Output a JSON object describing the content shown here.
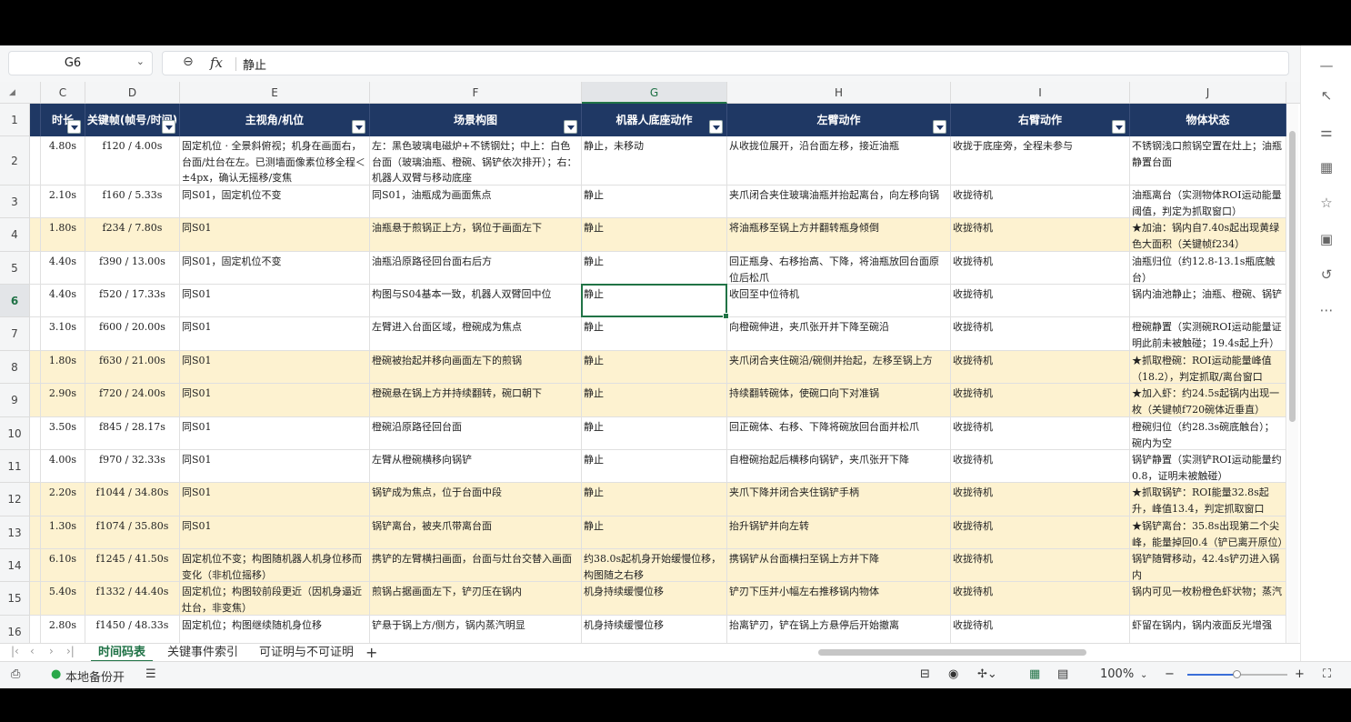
{
  "formula_bar": {
    "cell_ref": "G6",
    "fx_label": "fx",
    "value": "静止"
  },
  "columns": [
    {
      "letter": "C",
      "header": "时长"
    },
    {
      "letter": "D",
      "header": "关键帧(帧号/时间)"
    },
    {
      "letter": "E",
      "header": "主视角/机位"
    },
    {
      "letter": "F",
      "header": "场景构图"
    },
    {
      "letter": "G",
      "header": "机器人底座动作"
    },
    {
      "letter": "H",
      "header": "左臂动作"
    },
    {
      "letter": "I",
      "header": "右臂动作"
    },
    {
      "letter": "J",
      "header": "物体状态"
    }
  ],
  "rows": [
    {
      "num": "2",
      "C": "4.80s",
      "D": "f120 / 4.00s",
      "E": "固定机位 · 全景斜俯视；机身在画面右，台面/灶台在左。已测墙面像素位移全程＜±4px，确认无摇移/变焦",
      "F": "左：黑色玻璃电磁炉+不锈钢灶；中上：白色台面（玻璃油瓶、橙碗、锅铲依次排开）；右：机器人双臂与移动底座",
      "G": "静止，未移动",
      "H": "从收拢位展开，沿台面左移，接近油瓶",
      "I": "收拢于底座旁，全程未参与",
      "J": "不锈钢浅口煎锅空置在灶上；油瓶静置台面",
      "hl": false
    },
    {
      "num": "3",
      "C": "2.10s",
      "D": "f160 / 5.33s",
      "E": "同S01，固定机位不变",
      "F": "同S01，油瓶成为画面焦点",
      "G": "静止",
      "H": "夹爪闭合夹住玻璃油瓶并抬起离台，向左移向锅",
      "I": "收拢待机",
      "J": "油瓶离台（实测物体ROI运动能量阈值，判定为抓取窗口）",
      "hl": false
    },
    {
      "num": "4",
      "C": "1.80s",
      "D": "f234 / 7.80s",
      "E": "同S01",
      "F": "油瓶悬于煎锅正上方，锅位于画面左下",
      "G": "静止",
      "H": "将油瓶移至锅上方并翻转瓶身倾倒",
      "I": "收拢待机",
      "J": "★加油：锅内自7.40s起出现黄绿色大面积（关键帧f234）",
      "hl": true
    },
    {
      "num": "5",
      "C": "4.40s",
      "D": "f390 / 13.00s",
      "E": "同S01，固定机位不变",
      "F": "油瓶沿原路径回台面右后方",
      "G": "静止",
      "H": "回正瓶身、右移抬高、下降，将油瓶放回台面原位后松爪",
      "I": "收拢待机",
      "J": "油瓶归位（约12.8-13.1s瓶底触台）",
      "hl": false
    },
    {
      "num": "6",
      "C": "4.40s",
      "D": "f520 / 17.33s",
      "E": "同S01",
      "F": "构图与S04基本一致，机器人双臂回中位",
      "G": "静止",
      "H": "收回至中位待机",
      "I": "收拢待机",
      "J": "锅内油池静止；油瓶、橙碗、锅铲",
      "hl": false
    },
    {
      "num": "7",
      "C": "3.10s",
      "D": "f600 / 20.00s",
      "E": "同S01",
      "F": "左臂进入台面区域，橙碗成为焦点",
      "G": "静止",
      "H": "向橙碗伸进，夹爪张开并下降至碗沿",
      "I": "收拢待机",
      "J": "橙碗静置（实测碗ROI运动能量证明此前未被触碰；19.4s起上升）",
      "hl": false
    },
    {
      "num": "8",
      "C": "1.80s",
      "D": "f630 / 21.00s",
      "E": "同S01",
      "F": "橙碗被抬起并移向画面左下的煎锅",
      "G": "静止",
      "H": "夹爪闭合夹住碗沿/碗侧并抬起，左移至锅上方",
      "I": "收拢待机",
      "J": "★抓取橙碗：ROI运动能量峰值（18.2），判定抓取/离台窗口",
      "hl": true
    },
    {
      "num": "9",
      "C": "2.90s",
      "D": "f720 / 24.00s",
      "E": "同S01",
      "F": "橙碗悬在锅上方并持续翻转，碗口朝下",
      "G": "静止",
      "H": "持续翻转碗体，使碗口向下对准锅",
      "I": "收拢待机",
      "J": "★加入虾：约24.5s起锅内出现一枚（关键帧f720碗体近垂直）",
      "hl": true
    },
    {
      "num": "10",
      "C": "3.50s",
      "D": "f845 / 28.17s",
      "E": "同S01",
      "F": "橙碗沿原路径回台面",
      "G": "静止",
      "H": "回正碗体、右移、下降将碗放回台面并松爪",
      "I": "收拢待机",
      "J": "橙碗归位（约28.3s碗底触台）；碗内为空",
      "hl": false
    },
    {
      "num": "11",
      "C": "4.00s",
      "D": "f970 / 32.33s",
      "E": "同S01",
      "F": "左臂从橙碗横移向锅铲",
      "G": "静止",
      "H": "自橙碗抬起后横移向锅铲，夹爪张开下降",
      "I": "收拢待机",
      "J": "锅铲静置（实测铲ROI运动能量约0.8，证明未被触碰）",
      "hl": false
    },
    {
      "num": "12",
      "C": "2.20s",
      "D": "f1044 / 34.80s",
      "E": "同S01",
      "F": "锅铲成为焦点，位于台面中段",
      "G": "静止",
      "H": "夹爪下降并闭合夹住锅铲手柄",
      "I": "收拢待机",
      "J": "★抓取锅铲：ROI能量32.8s起升，峰值13.4，判定抓取窗口",
      "hl": true
    },
    {
      "num": "13",
      "C": "1.30s",
      "D": "f1074 / 35.80s",
      "E": "同S01",
      "F": "锅铲离台，被夹爪带离台面",
      "G": "静止",
      "H": "抬升锅铲并向左转",
      "I": "收拢待机",
      "J": "★锅铲离台：35.8s出现第二个尖峰，能量掉回0.4（铲已离开原位）",
      "hl": true
    },
    {
      "num": "14",
      "C": "6.10s",
      "D": "f1245 / 41.50s",
      "E": "固定机位不变；构图随机器人机身位移而变化（非机位摇移）",
      "F": "携铲的左臂横扫画面，台面与灶台交替入画面",
      "G": "约38.0s起机身开始缓慢位移，构图随之右移",
      "H": "携锅铲从台面横扫至锅上方并下降",
      "I": "收拢待机",
      "J": "锅铲随臂移动，42.4s铲刃进入锅内",
      "hl": true
    },
    {
      "num": "15",
      "C": "5.40s",
      "D": "f1332 / 44.40s",
      "E": "固定机位；构图较前段更近（因机身逼近灶台，非变焦）",
      "F": "煎锅占据画面左下，铲刃压在锅内",
      "G": "机身持续缓慢位移",
      "H": "铲刃下压并小幅左右推移锅内物体",
      "I": "收拢待机",
      "J": "锅内可见一枚粉橙色虾状物；蒸汽",
      "hl": true
    },
    {
      "num": "16",
      "C": "2.80s",
      "D": "f1450 / 48.33s",
      "E": "固定机位；构图继续随机身位移",
      "F": "铲悬于锅上方/侧方，锅内蒸汽明显",
      "G": "机身持续缓慢位移",
      "H": "抬离铲刃，铲在锅上方悬停后开始撤离",
      "I": "收拢待机",
      "J": "虾留在锅内，锅内液面反光增强",
      "hl": false
    }
  ],
  "tabs": {
    "active": "时间码表",
    "t2": "关键事件索引",
    "t3": "可证明与不可证明",
    "add": "+"
  },
  "status": {
    "backup": "本地备份开",
    "zoom": "100%",
    "zoom_level": 0.5
  },
  "colors": {
    "header_bg": "#1f3864",
    "highlight_row": "#fdf2d0",
    "accent": "#217346"
  }
}
